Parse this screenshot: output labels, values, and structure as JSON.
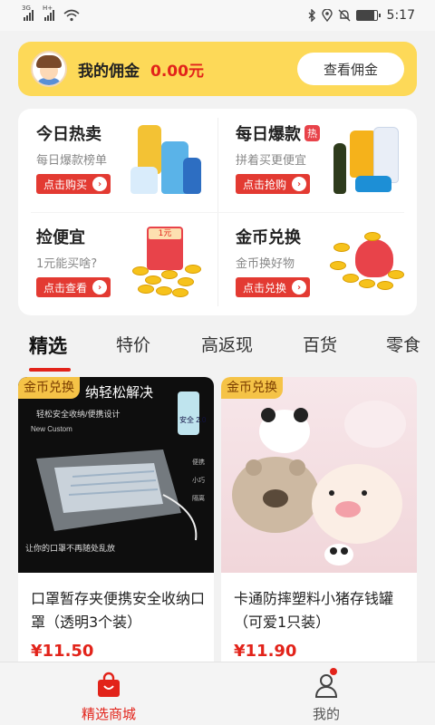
{
  "status_bar": {
    "signal_1": "3G",
    "signal_2": "H+",
    "time": "5:17",
    "battery_level": 0.9,
    "icons": [
      "signal-icon",
      "signal-icon",
      "wifi-icon",
      "bluetooth-icon",
      "location-icon",
      "mute-icon",
      "battery-icon"
    ]
  },
  "commission": {
    "label": "我的佣金",
    "amount": "0.00元",
    "button": "查看佣金"
  },
  "features": [
    {
      "title": "今日热卖",
      "subtitle": "每日爆款榜单",
      "button": "点击购买",
      "badge": ""
    },
    {
      "title": "每日爆款",
      "subtitle": "拼着买更便宜",
      "button": "点击抢购",
      "badge": "热"
    },
    {
      "title": "捡便宜",
      "subtitle": "1元能买啥?",
      "button": "点击查看",
      "badge": "",
      "envelope_label": "1元"
    },
    {
      "title": "金币兑换",
      "subtitle": "金币换好物",
      "button": "点击兑换",
      "badge": ""
    }
  ],
  "tabs": [
    "精选",
    "特价",
    "高返现",
    "百货",
    "零食"
  ],
  "active_tab": "精选",
  "products": [
    {
      "tag": "金币兑换",
      "title": "口罩暂存夹便携安全收纳口罩（透明3个装）",
      "price": "¥11.50",
      "image_text": {
        "headline": "纳轻松解决",
        "line": "轻松安全收纳/便携设计",
        "new_custom": "New Custom",
        "badge": "安全 2.0",
        "side_1": "便携",
        "side_2": "小巧",
        "side_3": "隔离",
        "footer": "让你的口罩不再随处乱放"
      }
    },
    {
      "tag": "金币兑换",
      "title": "卡通防摔塑料小猪存钱罐（可爱1只装）",
      "price": "¥11.90"
    }
  ],
  "bottom_nav": [
    {
      "label": "精选商城",
      "icon": "shopping-bag-icon",
      "active": true
    },
    {
      "label": "我的",
      "icon": "user-icon",
      "active": false,
      "has_dot": true
    }
  ],
  "colors": {
    "accent_red": "#e2231a",
    "banner_yellow": "#fdd958",
    "coin_tag": "#f5c347"
  }
}
